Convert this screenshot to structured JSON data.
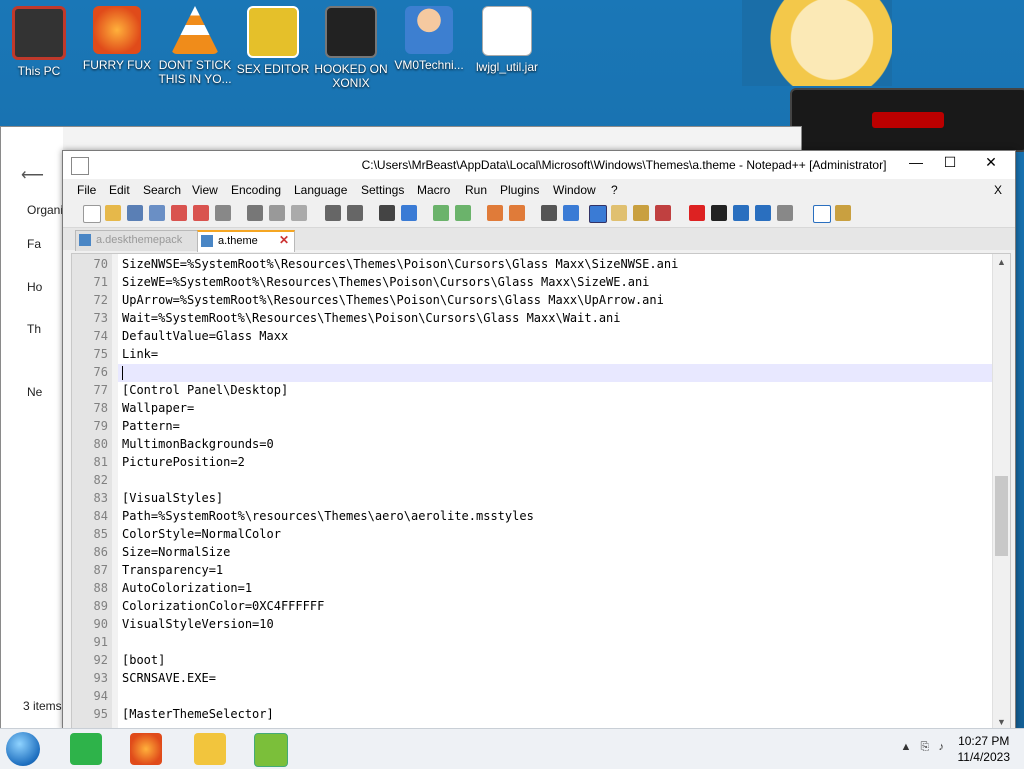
{
  "desktop": {
    "icons": [
      {
        "label": "This PC",
        "color": "#c0392b"
      },
      {
        "label": "FURRY FUX",
        "color": "#e86a1c"
      },
      {
        "label": "DONT STICK THIS IN YO...",
        "color": "#f08c1a"
      },
      {
        "label": "SEX EDITOR",
        "color": "#e5c02a"
      },
      {
        "label": "HOOKED ON XONIX",
        "color": "#333333"
      },
      {
        "label": "VM0Techni...",
        "color": "#3d7fd0"
      },
      {
        "label": "lwjgl_util.jar",
        "color": "#e04b1a"
      }
    ]
  },
  "explorer": {
    "sidebar": [
      "Organi",
      "Fa",
      "Ho",
      "Th",
      "Ne"
    ],
    "status": "3 items"
  },
  "notepad": {
    "title": "C:\\Users\\MrBeast\\AppData\\Local\\Microsoft\\Windows\\Themes\\a.theme - Notepad++ [Administrator]",
    "window_buttons": {
      "minimize": "—",
      "maximize": "☐",
      "close": "✕"
    },
    "menu": [
      "File",
      "Edit",
      "Search",
      "View",
      "Encoding",
      "Language",
      "Settings",
      "Macro",
      "Run",
      "Plugins",
      "Window",
      "?"
    ],
    "menu_close": "X",
    "tabs": [
      {
        "label": "a.deskthemepack",
        "active": false
      },
      {
        "label": "a.theme",
        "active": true
      }
    ],
    "lines": [
      {
        "n": "70",
        "text": "SizeNWSE=%SystemRoot%\\Resources\\Themes\\Poison\\Cursors\\Glass Maxx\\SizeNWSE.ani"
      },
      {
        "n": "71",
        "text": "SizeWE=%SystemRoot%\\Resources\\Themes\\Poison\\Cursors\\Glass Maxx\\SizeWE.ani"
      },
      {
        "n": "72",
        "text": "UpArrow=%SystemRoot%\\Resources\\Themes\\Poison\\Cursors\\Glass Maxx\\UpArrow.ani"
      },
      {
        "n": "73",
        "text": "Wait=%SystemRoot%\\Resources\\Themes\\Poison\\Cursors\\Glass Maxx\\Wait.ani"
      },
      {
        "n": "74",
        "text": "DefaultValue=Glass Maxx"
      },
      {
        "n": "75",
        "text": "Link="
      },
      {
        "n": "76",
        "text": ""
      },
      {
        "n": "77",
        "text": "[Control Panel\\Desktop]"
      },
      {
        "n": "78",
        "text": "Wallpaper="
      },
      {
        "n": "79",
        "text": "Pattern="
      },
      {
        "n": "80",
        "text": "MultimonBackgrounds=0"
      },
      {
        "n": "81",
        "text": "PicturePosition=2"
      },
      {
        "n": "82",
        "text": ""
      },
      {
        "n": "83",
        "text": "[VisualStyles]"
      },
      {
        "n": "84",
        "text": "Path=%SystemRoot%\\resources\\Themes\\aero\\aerolite.msstyles"
      },
      {
        "n": "85",
        "text": "ColorStyle=NormalColor"
      },
      {
        "n": "86",
        "text": "Size=NormalSize"
      },
      {
        "n": "87",
        "text": "Transparency=1"
      },
      {
        "n": "88",
        "text": "AutoColorization=1"
      },
      {
        "n": "89",
        "text": "ColorizationColor=0XC4FFFFFF"
      },
      {
        "n": "90",
        "text": "VisualStyleVersion=10"
      },
      {
        "n": "91",
        "text": ""
      },
      {
        "n": "92",
        "text": "[boot]"
      },
      {
        "n": "93",
        "text": "SCRNSAVE.EXE="
      },
      {
        "n": "94",
        "text": ""
      },
      {
        "n": "95",
        "text": "[MasterThemeSelector]"
      }
    ],
    "current_line": "76"
  },
  "taskbar": {
    "time": "10:27 PM",
    "date": "11/4/2023",
    "apps": [
      {
        "name": "notes-app",
        "color": "#2eb34a"
      },
      {
        "name": "firefox",
        "color": "#e86a1c"
      },
      {
        "name": "file-explorer",
        "color": "#f2c53d"
      },
      {
        "name": "notepad-plus-plus",
        "color": "#7bbf3a"
      }
    ]
  }
}
